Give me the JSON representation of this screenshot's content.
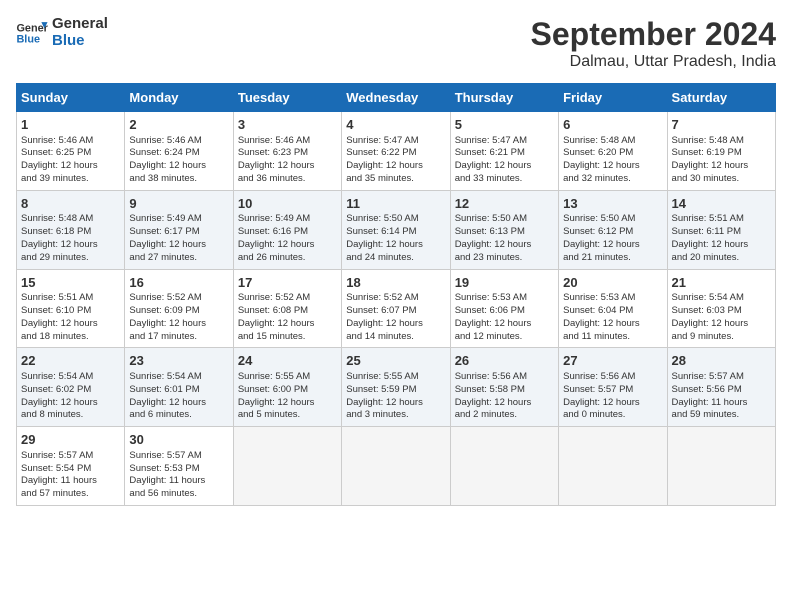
{
  "logo": {
    "line1": "General",
    "line2": "Blue"
  },
  "title": "September 2024",
  "subtitle": "Dalmau, Uttar Pradesh, India",
  "days_header": [
    "Sunday",
    "Monday",
    "Tuesday",
    "Wednesday",
    "Thursday",
    "Friday",
    "Saturday"
  ],
  "weeks": [
    [
      {
        "day": "1",
        "lines": [
          "Sunrise: 5:46 AM",
          "Sunset: 6:25 PM",
          "Daylight: 12 hours",
          "and 39 minutes."
        ]
      },
      {
        "day": "2",
        "lines": [
          "Sunrise: 5:46 AM",
          "Sunset: 6:24 PM",
          "Daylight: 12 hours",
          "and 38 minutes."
        ]
      },
      {
        "day": "3",
        "lines": [
          "Sunrise: 5:46 AM",
          "Sunset: 6:23 PM",
          "Daylight: 12 hours",
          "and 36 minutes."
        ]
      },
      {
        "day": "4",
        "lines": [
          "Sunrise: 5:47 AM",
          "Sunset: 6:22 PM",
          "Daylight: 12 hours",
          "and 35 minutes."
        ]
      },
      {
        "day": "5",
        "lines": [
          "Sunrise: 5:47 AM",
          "Sunset: 6:21 PM",
          "Daylight: 12 hours",
          "and 33 minutes."
        ]
      },
      {
        "day": "6",
        "lines": [
          "Sunrise: 5:48 AM",
          "Sunset: 6:20 PM",
          "Daylight: 12 hours",
          "and 32 minutes."
        ]
      },
      {
        "day": "7",
        "lines": [
          "Sunrise: 5:48 AM",
          "Sunset: 6:19 PM",
          "Daylight: 12 hours",
          "and 30 minutes."
        ]
      }
    ],
    [
      {
        "day": "8",
        "lines": [
          "Sunrise: 5:48 AM",
          "Sunset: 6:18 PM",
          "Daylight: 12 hours",
          "and 29 minutes."
        ]
      },
      {
        "day": "9",
        "lines": [
          "Sunrise: 5:49 AM",
          "Sunset: 6:17 PM",
          "Daylight: 12 hours",
          "and 27 minutes."
        ]
      },
      {
        "day": "10",
        "lines": [
          "Sunrise: 5:49 AM",
          "Sunset: 6:16 PM",
          "Daylight: 12 hours",
          "and 26 minutes."
        ]
      },
      {
        "day": "11",
        "lines": [
          "Sunrise: 5:50 AM",
          "Sunset: 6:14 PM",
          "Daylight: 12 hours",
          "and 24 minutes."
        ]
      },
      {
        "day": "12",
        "lines": [
          "Sunrise: 5:50 AM",
          "Sunset: 6:13 PM",
          "Daylight: 12 hours",
          "and 23 minutes."
        ]
      },
      {
        "day": "13",
        "lines": [
          "Sunrise: 5:50 AM",
          "Sunset: 6:12 PM",
          "Daylight: 12 hours",
          "and 21 minutes."
        ]
      },
      {
        "day": "14",
        "lines": [
          "Sunrise: 5:51 AM",
          "Sunset: 6:11 PM",
          "Daylight: 12 hours",
          "and 20 minutes."
        ]
      }
    ],
    [
      {
        "day": "15",
        "lines": [
          "Sunrise: 5:51 AM",
          "Sunset: 6:10 PM",
          "Daylight: 12 hours",
          "and 18 minutes."
        ]
      },
      {
        "day": "16",
        "lines": [
          "Sunrise: 5:52 AM",
          "Sunset: 6:09 PM",
          "Daylight: 12 hours",
          "and 17 minutes."
        ]
      },
      {
        "day": "17",
        "lines": [
          "Sunrise: 5:52 AM",
          "Sunset: 6:08 PM",
          "Daylight: 12 hours",
          "and 15 minutes."
        ]
      },
      {
        "day": "18",
        "lines": [
          "Sunrise: 5:52 AM",
          "Sunset: 6:07 PM",
          "Daylight: 12 hours",
          "and 14 minutes."
        ]
      },
      {
        "day": "19",
        "lines": [
          "Sunrise: 5:53 AM",
          "Sunset: 6:06 PM",
          "Daylight: 12 hours",
          "and 12 minutes."
        ]
      },
      {
        "day": "20",
        "lines": [
          "Sunrise: 5:53 AM",
          "Sunset: 6:04 PM",
          "Daylight: 12 hours",
          "and 11 minutes."
        ]
      },
      {
        "day": "21",
        "lines": [
          "Sunrise: 5:54 AM",
          "Sunset: 6:03 PM",
          "Daylight: 12 hours",
          "and 9 minutes."
        ]
      }
    ],
    [
      {
        "day": "22",
        "lines": [
          "Sunrise: 5:54 AM",
          "Sunset: 6:02 PM",
          "Daylight: 12 hours",
          "and 8 minutes."
        ]
      },
      {
        "day": "23",
        "lines": [
          "Sunrise: 5:54 AM",
          "Sunset: 6:01 PM",
          "Daylight: 12 hours",
          "and 6 minutes."
        ]
      },
      {
        "day": "24",
        "lines": [
          "Sunrise: 5:55 AM",
          "Sunset: 6:00 PM",
          "Daylight: 12 hours",
          "and 5 minutes."
        ]
      },
      {
        "day": "25",
        "lines": [
          "Sunrise: 5:55 AM",
          "Sunset: 5:59 PM",
          "Daylight: 12 hours",
          "and 3 minutes."
        ]
      },
      {
        "day": "26",
        "lines": [
          "Sunrise: 5:56 AM",
          "Sunset: 5:58 PM",
          "Daylight: 12 hours",
          "and 2 minutes."
        ]
      },
      {
        "day": "27",
        "lines": [
          "Sunrise: 5:56 AM",
          "Sunset: 5:57 PM",
          "Daylight: 12 hours",
          "and 0 minutes."
        ]
      },
      {
        "day": "28",
        "lines": [
          "Sunrise: 5:57 AM",
          "Sunset: 5:56 PM",
          "Daylight: 11 hours",
          "and 59 minutes."
        ]
      }
    ],
    [
      {
        "day": "29",
        "lines": [
          "Sunrise: 5:57 AM",
          "Sunset: 5:54 PM",
          "Daylight: 11 hours",
          "and 57 minutes."
        ]
      },
      {
        "day": "30",
        "lines": [
          "Sunrise: 5:57 AM",
          "Sunset: 5:53 PM",
          "Daylight: 11 hours",
          "and 56 minutes."
        ]
      },
      {
        "day": "",
        "lines": []
      },
      {
        "day": "",
        "lines": []
      },
      {
        "day": "",
        "lines": []
      },
      {
        "day": "",
        "lines": []
      },
      {
        "day": "",
        "lines": []
      }
    ]
  ]
}
